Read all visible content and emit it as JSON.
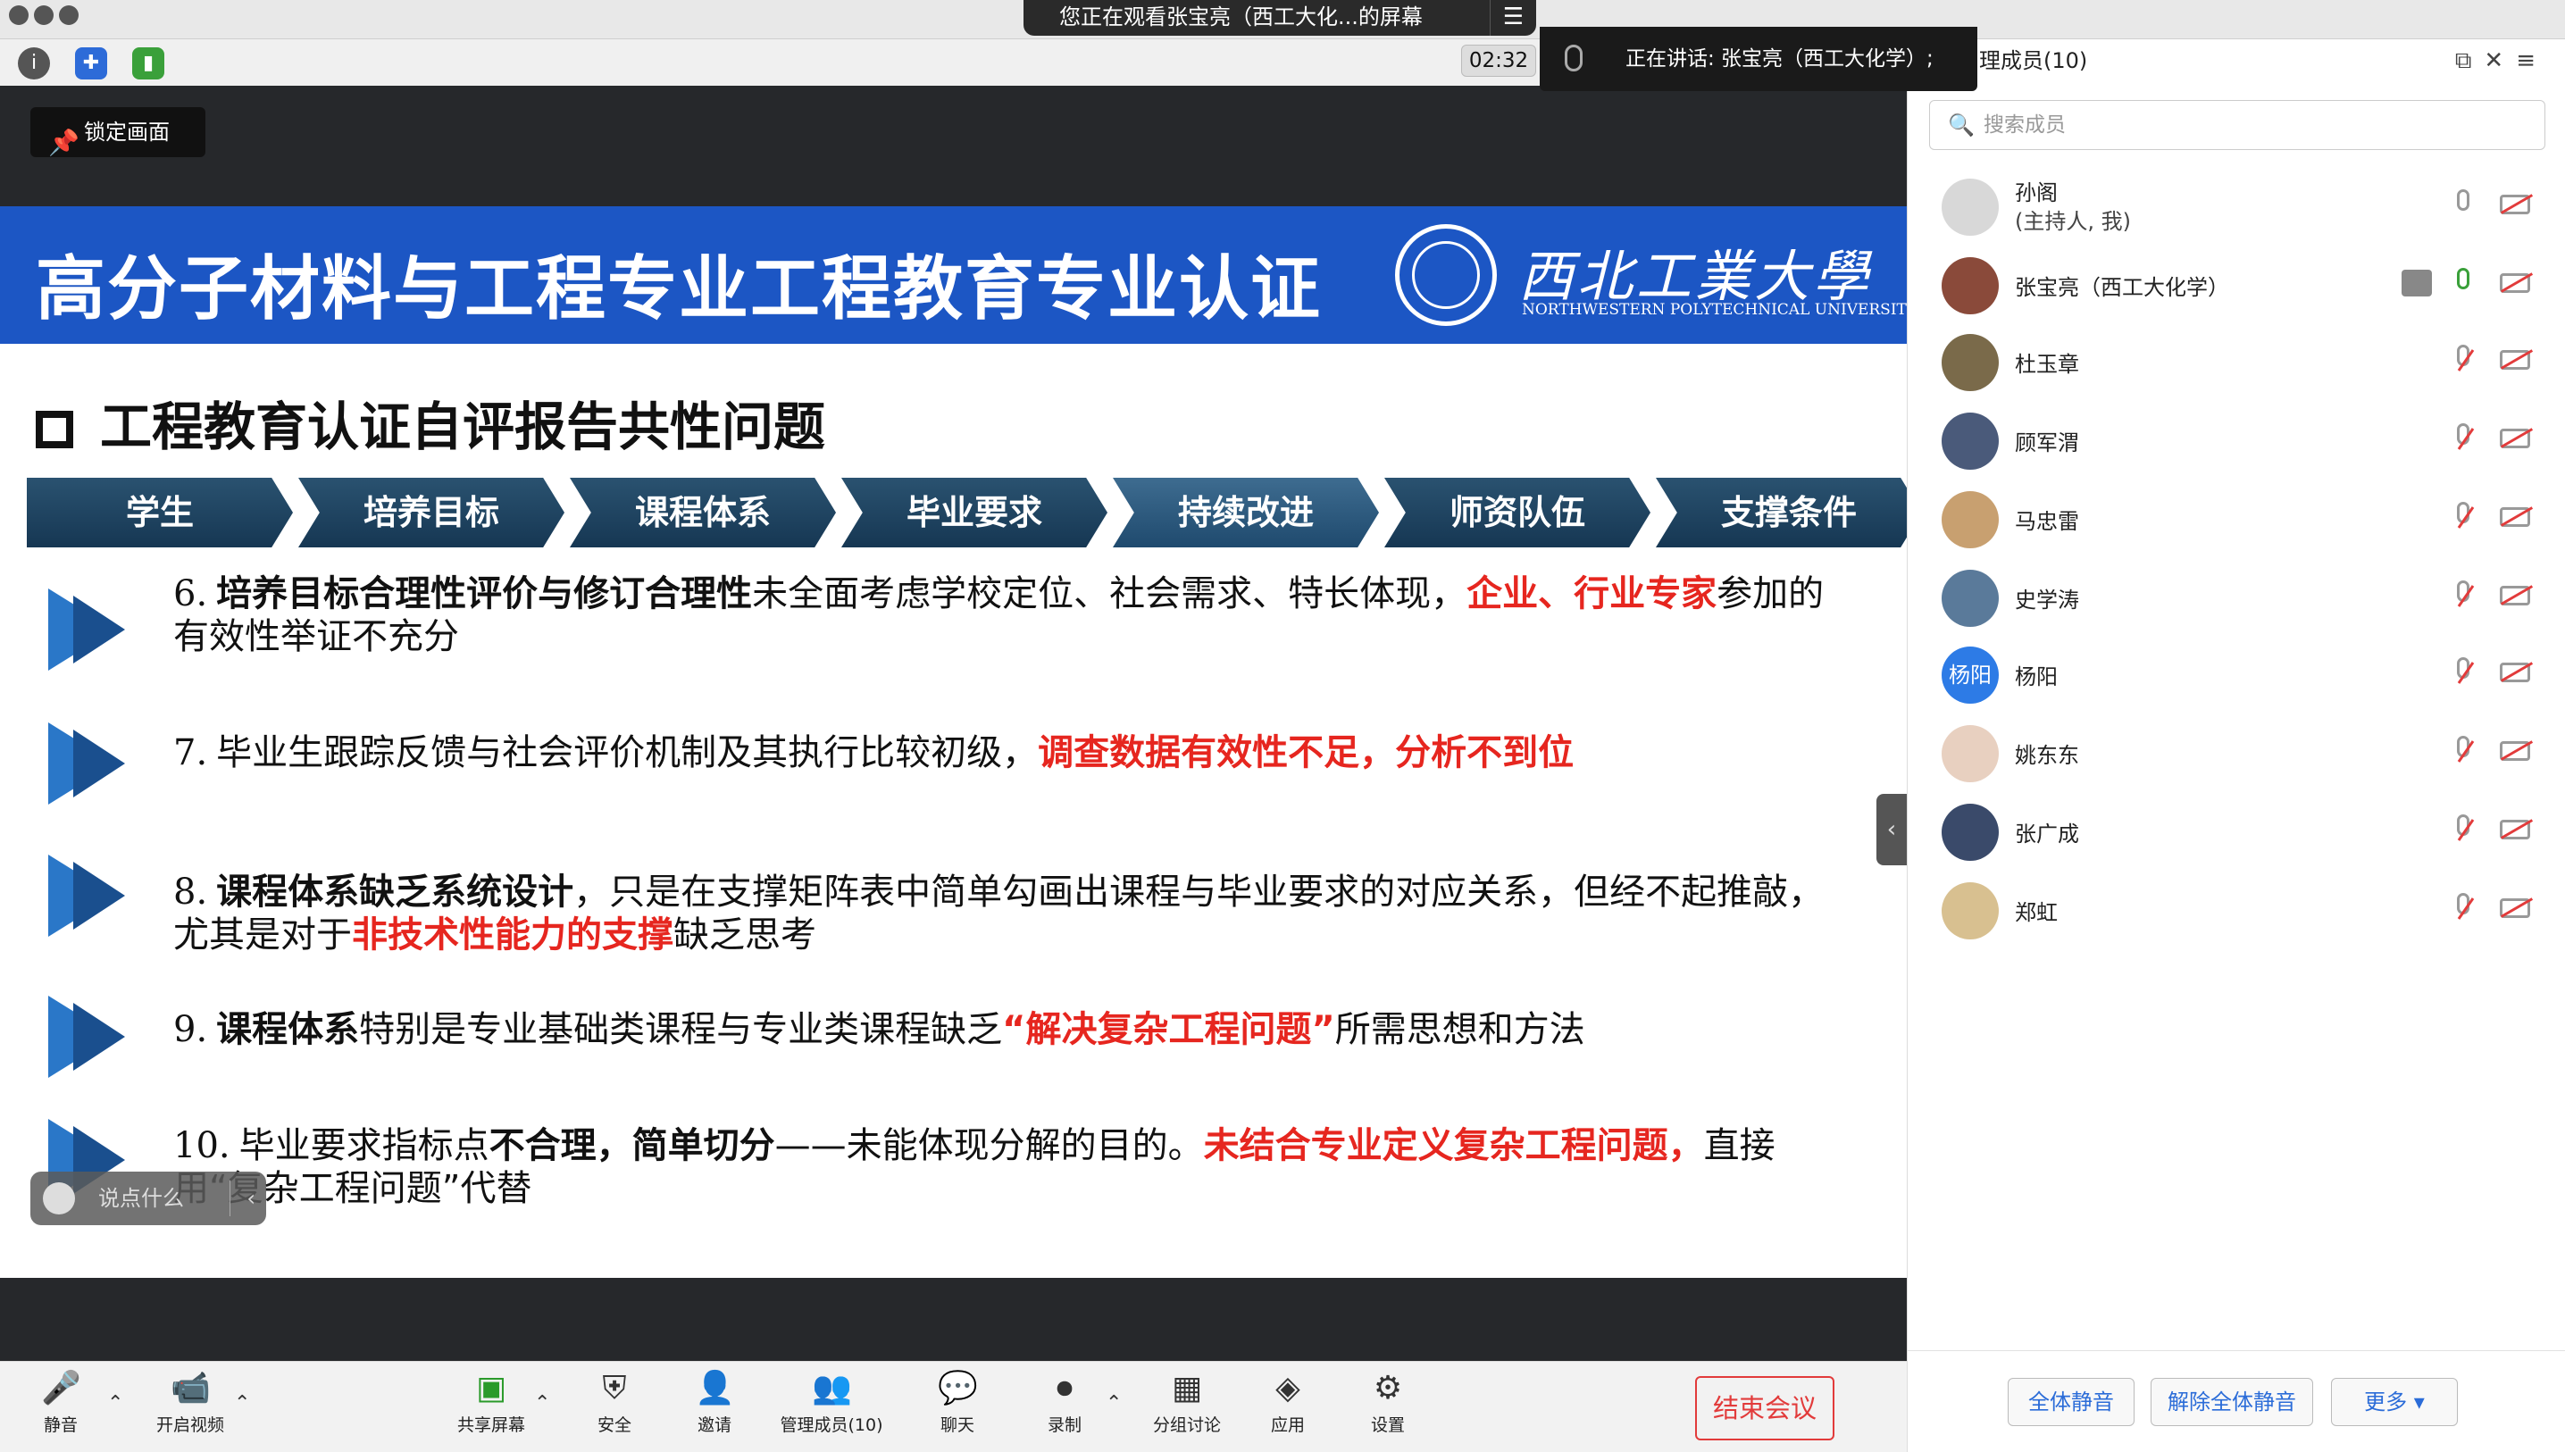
{
  "top_banner": {
    "sharing_text": "您正在观看张宝亮（西工大化...的屏幕",
    "menu_icon": "list-icon"
  },
  "timer": "02:32",
  "speaking": "正在讲话: 张宝亮（西工大化学）;",
  "lock_screen_label": "锁定画面",
  "slide": {
    "title": "高分子材料与工程专业工程教育专业认证",
    "university_cn": "西北工業大學",
    "university_en": "NORTHWESTERN POLYTECHNICAL UNIVERSITY",
    "subtitle": "工程教育认证自评报告共性问题",
    "steps": [
      "学生",
      "培养目标",
      "课程体系",
      "毕业要求",
      "持续改进",
      "师资队伍",
      "支撑条件"
    ],
    "items": [
      {
        "n": "6.",
        "segments": [
          {
            "t": "培养目标合理性评价与修订合理性",
            "s": "bold"
          },
          {
            "t": "未全面考虑学校定位、社会需求、特长体现，",
            "s": ""
          },
          {
            "t": "企业、行业专家",
            "s": "red"
          },
          {
            "t": "参加的有效性举证不充分",
            "s": ""
          }
        ]
      },
      {
        "n": "7.",
        "segments": [
          {
            "t": "毕业生跟踪反馈与社会评价机制及其执行比较初级，",
            "s": ""
          },
          {
            "t": "调查数据有效性不足，分析不到位",
            "s": "red"
          }
        ]
      },
      {
        "n": "8.",
        "segments": [
          {
            "t": "课程体系缺乏系统设计",
            "s": "bold"
          },
          {
            "t": "，只是在支撑矩阵表中简单勾画出课程与毕业要求的对应关系，但经不起推敲，尤其是对于",
            "s": ""
          },
          {
            "t": "非技术性能力的支撑",
            "s": "red"
          },
          {
            "t": "缺乏思考",
            "s": ""
          }
        ]
      },
      {
        "n": "9.",
        "segments": [
          {
            "t": "课程体系",
            "s": "bold"
          },
          {
            "t": "特别是专业基础类课程与专业类课程缺乏",
            "s": ""
          },
          {
            "t": "“解决复杂工程问题”",
            "s": "red"
          },
          {
            "t": "所需思想和方法",
            "s": ""
          }
        ]
      },
      {
        "n": "10.",
        "segments": [
          {
            "t": "毕业要求指标点",
            "s": ""
          },
          {
            "t": "不合理，简单切分",
            "s": "bold"
          },
          {
            "t": "——未能体现分解的目的。",
            "s": ""
          },
          {
            "t": "未结合专业定义复杂工程问题，",
            "s": "red"
          },
          {
            "t": "直接用“复杂工程问题”代替",
            "s": ""
          }
        ]
      }
    ]
  },
  "chat_input_placeholder": "说点什么",
  "bottom_bar": {
    "mute": "静音",
    "video": "开启视频",
    "share": "共享屏幕",
    "security": "安全",
    "invite": "邀请",
    "manage": "管理成员(10)",
    "chat": "聊天",
    "record": "录制",
    "breakout": "分组讨论",
    "apps": "应用",
    "settings": "设置",
    "end": "结束会议"
  },
  "panel": {
    "title": "理成员(10)",
    "search_placeholder": "搜索成员",
    "members": [
      {
        "name": "孙阁",
        "sub": "(主持人, 我)",
        "mic": "on",
        "avatar_color": "#d8d8d8",
        "avatar_text": ""
      },
      {
        "name": "张宝亮（西工大化学）",
        "sub": "",
        "mic": "on",
        "sharing": true,
        "avatar_color": "#8a4a3a",
        "avatar_text": ""
      },
      {
        "name": "杜玉章",
        "sub": "",
        "mic": "off",
        "avatar_color": "#7a6a4a",
        "avatar_text": ""
      },
      {
        "name": "顾军渭",
        "sub": "",
        "mic": "off",
        "avatar_color": "#4a5a7a",
        "avatar_text": ""
      },
      {
        "name": "马忠雷",
        "sub": "",
        "mic": "off",
        "avatar_color": "#c8a070",
        "avatar_text": ""
      },
      {
        "name": "史学涛",
        "sub": "",
        "mic": "off",
        "avatar_color": "#5a7a9a",
        "avatar_text": ""
      },
      {
        "name": "杨阳",
        "sub": "",
        "mic": "off",
        "avatar_color": "#2d7be6",
        "avatar_text": "杨阳"
      },
      {
        "name": "姚东东",
        "sub": "",
        "mic": "off",
        "avatar_color": "#e8d0c0",
        "avatar_text": ""
      },
      {
        "name": "张广成",
        "sub": "",
        "mic": "off",
        "avatar_color": "#3a4a6a",
        "avatar_text": ""
      },
      {
        "name": "郑虹",
        "sub": "",
        "mic": "off",
        "avatar_color": "#d8c090",
        "avatar_text": ""
      }
    ],
    "footer": {
      "mute_all": "全体静音",
      "unmute_all": "解除全体静音",
      "more": "更多 ▾"
    }
  }
}
